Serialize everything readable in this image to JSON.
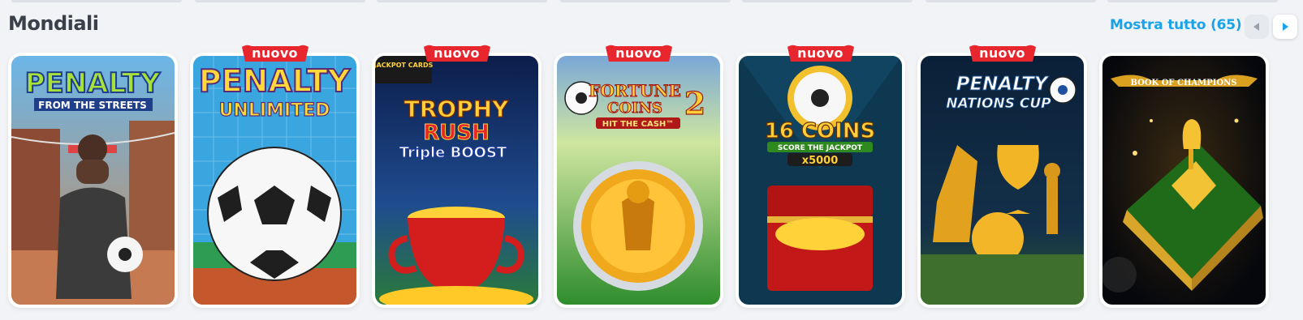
{
  "section": {
    "title": "Mondiali",
    "show_all": "Mostra tutto (65)"
  },
  "colors": {
    "accent": "#1aa3e8",
    "badge": "#e8262d",
    "title": "#3a3f49"
  },
  "icons": {
    "prev": "chevron-left-icon",
    "next": "chevron-right-icon"
  },
  "badge_label": "nuovo",
  "games": [
    {
      "title_line1": "PENALTY",
      "title_line2": "FROM THE STREETS",
      "is_new": false
    },
    {
      "title_line1": "PENALTY",
      "title_line2": "UNLIMITED",
      "is_new": true
    },
    {
      "corner": "JACKPOT CARDS",
      "title_line1": "TROPHY",
      "title_line2": "RUSH",
      "title_line3": "Triple BOOST",
      "is_new": true
    },
    {
      "title_line1": "FORTUNE",
      "title_line2": "COINS",
      "title_number": "2",
      "title_line3": "HIT THE CASH™",
      "is_new": true
    },
    {
      "title_line1": "16 COINS",
      "title_line2": "SCORE THE JACKPOT",
      "title_line3": "x5000",
      "is_new": true
    },
    {
      "title_line1": "PENALTY",
      "title_line2": "NATIONS CUP",
      "is_new": true
    },
    {
      "title_line1": "BOOK OF CHAMPIONS",
      "is_new": false
    }
  ]
}
